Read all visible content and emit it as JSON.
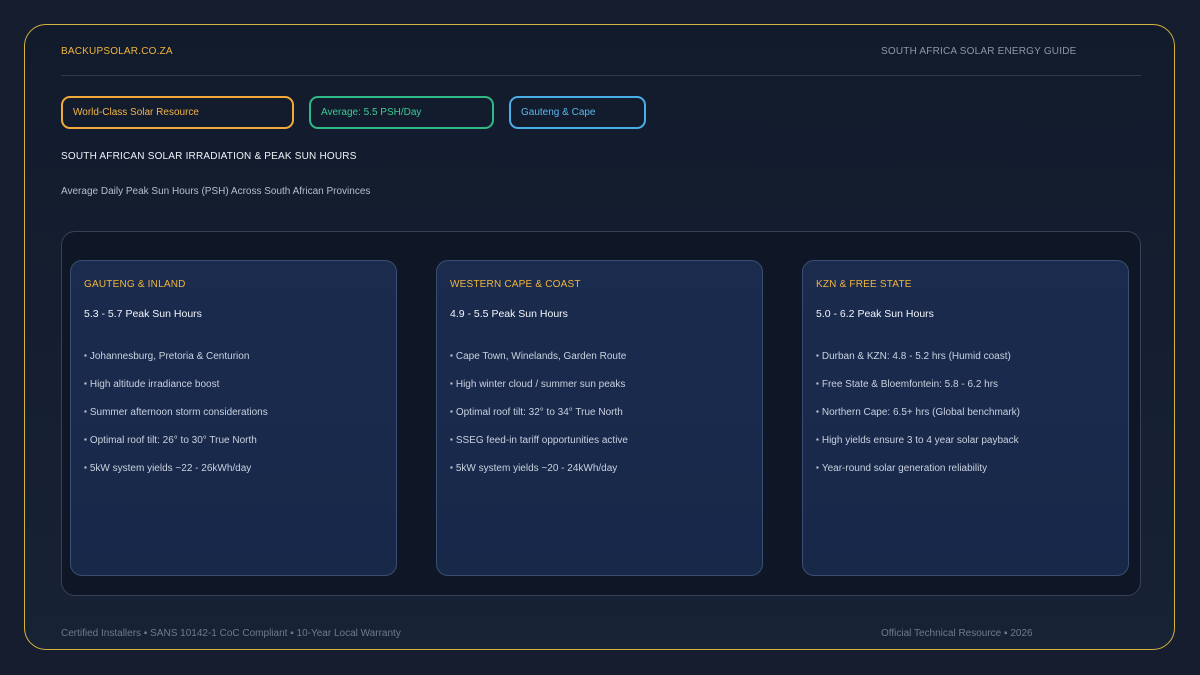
{
  "header": {
    "brand": "BACKUPSOLAR.CO.ZA",
    "guide": "SOUTH AFRICA SOLAR ENERGY GUIDE"
  },
  "badges": [
    {
      "label": "World-Class Solar Resource",
      "color": "#f2a93a"
    },
    {
      "label": "Average: 5.5 PSH/Day",
      "color": "#2fb986"
    },
    {
      "label": "Gauteng & Cape",
      "color": "#4aaee6"
    }
  ],
  "section_title": "SOUTH AFRICAN SOLAR IRRADIATION & PEAK SUN HOURS",
  "subtitle": "Average Daily Peak Sun Hours (PSH) Across South African Provinces",
  "bullet_glyph": "▪",
  "cards": [
    {
      "title": "GAUTENG & INLAND",
      "psh": "5.3 - 5.7 Peak Sun Hours",
      "items": [
        "Johannesburg, Pretoria & Centurion",
        "High altitude irradiance boost",
        "Summer afternoon storm considerations",
        "Optimal roof tilt: 26° to 30° True North",
        "5kW system yields ~22 - 26kWh/day"
      ]
    },
    {
      "title": "WESTERN CAPE & COAST",
      "psh": "4.9 - 5.5 Peak Sun Hours",
      "items": [
        "Cape Town, Winelands, Garden Route",
        "High winter cloud / summer sun peaks",
        "Optimal roof tilt: 32° to 34° True North",
        "SSEG feed-in tariff opportunities active",
        "5kW system yields ~20 - 24kWh/day"
      ]
    },
    {
      "title": "KZN & FREE STATE",
      "psh": "5.0 - 6.2 Peak Sun Hours",
      "items": [
        "Durban & KZN: 4.8 - 5.2 hrs (Humid coast)",
        "Free State & Bloemfontein: 5.8 - 6.2 hrs",
        "Northern Cape: 6.5+ hrs (Global benchmark)",
        "High yields ensure 3 to 4 year solar payback",
        "Year-round solar generation reliability"
      ]
    }
  ],
  "footer": {
    "left": "Certified Installers ▪ SANS 10142-1 CoC Compliant ▪ 10-Year Local Warranty",
    "right": "Official Technical Resource ▪ 2026"
  }
}
